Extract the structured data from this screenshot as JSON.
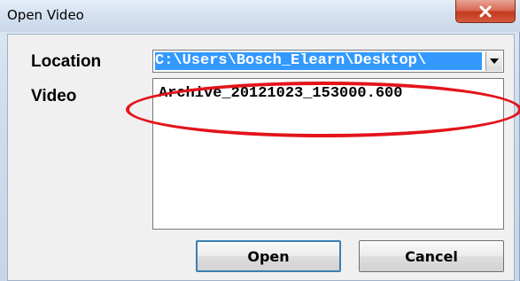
{
  "window": {
    "title": "Open Video",
    "close_glyph": "x"
  },
  "form": {
    "location_label": "Location",
    "location_value": "C:\\Users\\Bosch_Elearn\\Desktop\\",
    "video_label": "Video",
    "video_items": [
      "Archive_20121023_153000.600"
    ]
  },
  "buttons": {
    "open_label": "Open",
    "cancel_label": "Cancel"
  },
  "annotation": {
    "highlight_color": "#e3141b"
  },
  "icons": {
    "close": "close-icon",
    "dropdown": "chevron-down-icon"
  }
}
